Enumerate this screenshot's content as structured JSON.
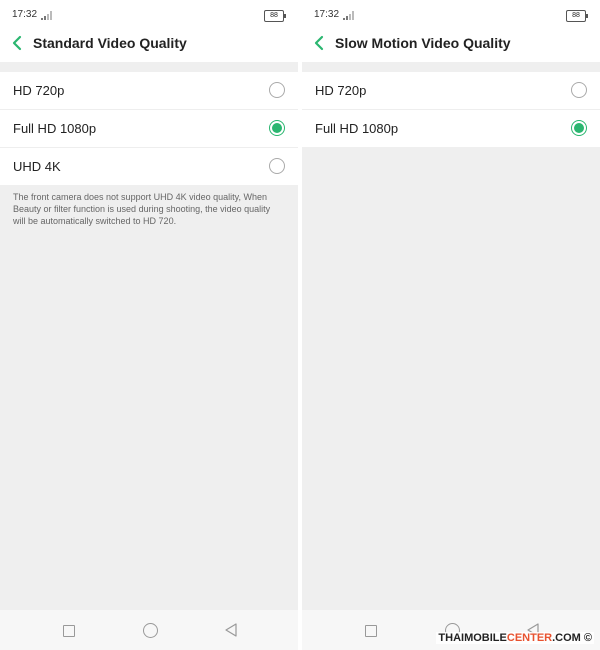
{
  "colors": {
    "accent": "#2bb670",
    "background": "#efefef",
    "watermark_accent": "#e8522f"
  },
  "screens": [
    {
      "status": {
        "time": "17:32",
        "battery": "88"
      },
      "title": "Standard Video Quality",
      "options": [
        {
          "label": "HD 720p",
          "selected": false
        },
        {
          "label": "Full HD 1080p",
          "selected": true
        },
        {
          "label": "UHD 4K",
          "selected": false
        }
      ],
      "note": "The front camera does not support UHD 4K video quality, When Beauty or filter function is used during shooting, the video quality will be automatically switched to HD 720."
    },
    {
      "status": {
        "time": "17:32",
        "battery": "88"
      },
      "title": "Slow Motion Video Quality",
      "options": [
        {
          "label": "HD 720p",
          "selected": false
        },
        {
          "label": "Full HD 1080p",
          "selected": true
        }
      ]
    }
  ],
  "watermark": {
    "prefix": "THAIMOBILE",
    "accent": "CENTER",
    "suffix": ".COM ©"
  },
  "icons": [
    "back-arrow-icon",
    "signal-icon",
    "battery-icon",
    "radio-icon",
    "nav-square-icon",
    "nav-circle-icon",
    "nav-back-icon"
  ]
}
